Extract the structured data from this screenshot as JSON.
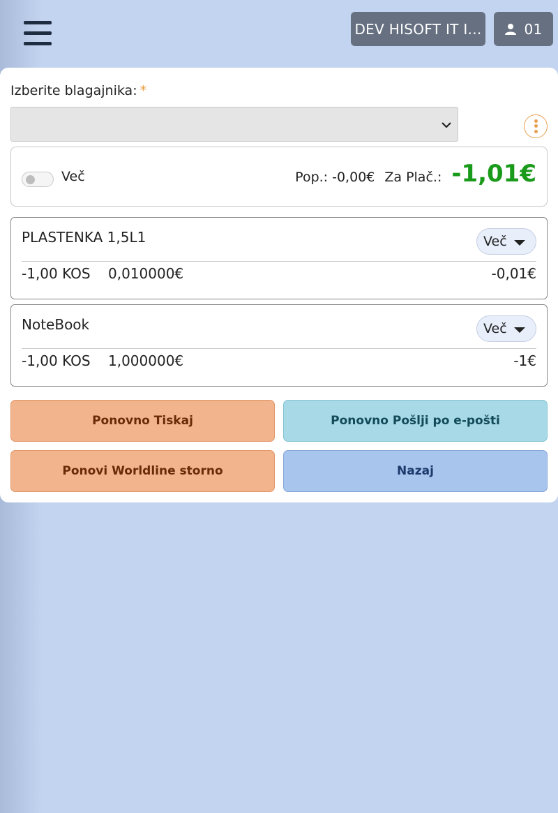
{
  "header": {
    "company_label": "DEV HISOFT IT I...",
    "user_label": "01",
    "menu_icon": "hamburger-icon",
    "user_icon": "user-icon"
  },
  "form": {
    "cashier_label": "Izberite blagajnika:",
    "required_mark": "*",
    "cashier_value": ""
  },
  "summary": {
    "toggle_label": "Več",
    "discount_text": "Pop.: -0,00€",
    "to_pay_label": "Za Plač.:",
    "to_pay_value": "-1,01€"
  },
  "items": [
    {
      "name": "PLASTENKA 1,5L1",
      "more_label": "Več",
      "qty": "-1,00 KOS",
      "price": "0,010000€",
      "total": "-0,01€"
    },
    {
      "name": "NoteBook",
      "more_label": "Več",
      "qty": "-1,00 KOS",
      "price": "1,000000€",
      "total": "-1€"
    }
  ],
  "actions": {
    "reprint": "Ponovno Tiskaj",
    "resend_email": "Ponovno Pošlji po e-pošti",
    "worldline_storno": "Ponovi Worldline storno",
    "back": "Nazaj"
  },
  "colors": {
    "background": "#c3d4f0",
    "header_button": "#667081",
    "total_green": "#1a9a1a",
    "accent_orange": "#e8a050",
    "btn_orange": "#f2b48c",
    "btn_cyan": "#a7d9e6",
    "btn_blue": "#a8c5ee"
  }
}
